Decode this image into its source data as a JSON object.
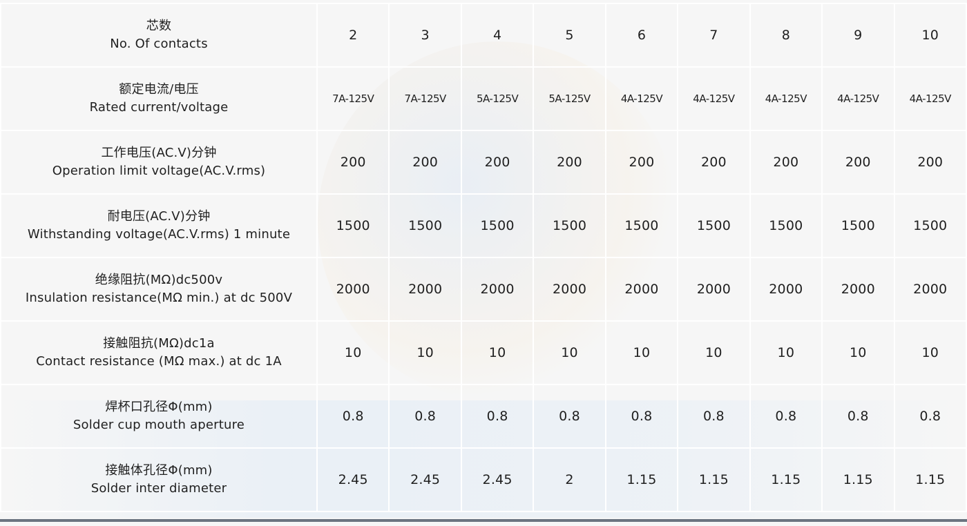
{
  "table": {
    "columns": [
      "2",
      "3",
      "4",
      "5",
      "6",
      "7",
      "8",
      "9",
      "10"
    ],
    "rows": [
      {
        "label_zh": "芯数",
        "label_en": "No. Of contacts",
        "values": [
          "2",
          "3",
          "4",
          "5",
          "6",
          "7",
          "8",
          "9",
          "10"
        ]
      },
      {
        "label_zh": "额定电流/电压",
        "label_en": "Rated current/voltage",
        "values": [
          "7A-125V",
          "7A-125V",
          "5A-125V",
          "5A-125V",
          "4A-125V",
          "4A-125V",
          "4A-125V",
          "4A-125V",
          "4A-125V"
        ]
      },
      {
        "label_zh": "工作电压(AC.V)分钟",
        "label_en": "Operation limit voltage(AC.V.rms)",
        "values": [
          "200",
          "200",
          "200",
          "200",
          "200",
          "200",
          "200",
          "200",
          "200"
        ]
      },
      {
        "label_zh": "耐电压(AC.V)分钟",
        "label_en": "Withstanding voltage(AC.V.rms) 1 minute",
        "values": [
          "1500",
          "1500",
          "1500",
          "1500",
          "1500",
          "1500",
          "1500",
          "1500",
          "1500"
        ]
      },
      {
        "label_zh": "绝缘阻抗(MΩ)dc500v",
        "label_en": "Insulation resistance(MΩ min.) at dc 500V",
        "values": [
          "2000",
          "2000",
          "2000",
          "2000",
          "2000",
          "2000",
          "2000",
          "2000",
          "2000"
        ]
      },
      {
        "label_zh": "接触阻抗(MΩ)dc1a",
        "label_en": "Contact resistance (MΩ max.) at dc 1A",
        "values": [
          "10",
          "10",
          "10",
          "10",
          "10",
          "10",
          "10",
          "10",
          "10"
        ]
      },
      {
        "label_zh": "焊杯口孔径Φ(mm)",
        "label_en": "Solder cup mouth aperture",
        "values": [
          "0.8",
          "0.8",
          "0.8",
          "0.8",
          "0.8",
          "0.8",
          "0.8",
          "0.8",
          "0.8"
        ]
      },
      {
        "label_zh": "接触体孔径Φ(mm)",
        "label_en": "Solder inter diameter",
        "values": [
          "2.45",
          "2.45",
          "2.45",
          "2",
          "1.15",
          "1.15",
          "1.15",
          "1.15",
          "1.15"
        ]
      }
    ]
  },
  "colors": {
    "background": "#f6f6f6",
    "grid_line": "#ffffff",
    "text": "#1f1f1f",
    "bottom_rule": "#6b7480"
  }
}
